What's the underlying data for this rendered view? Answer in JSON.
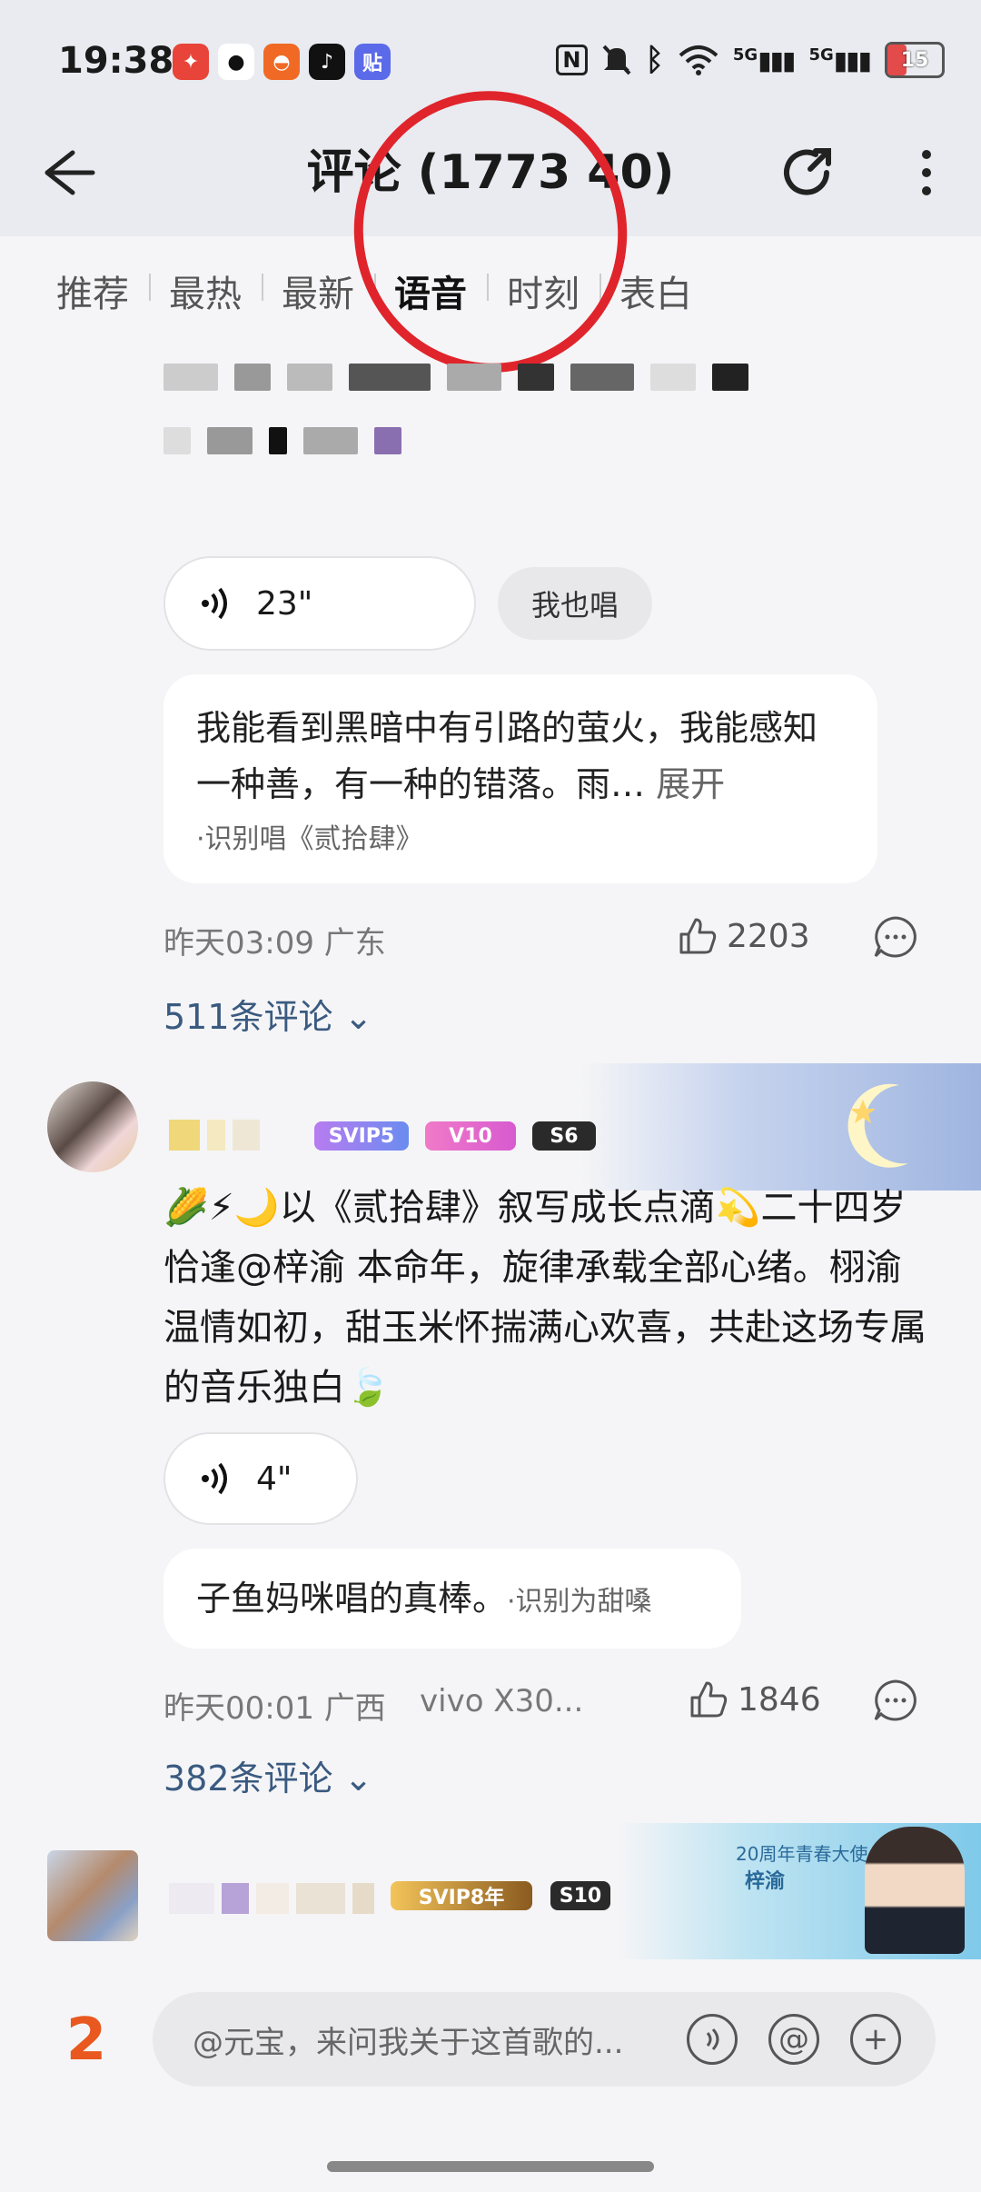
{
  "status_bar": {
    "time": "19:38",
    "app_badge": "贴",
    "network_1": "5G",
    "network_2": "5G",
    "battery": "15",
    "icons": [
      "nfc-icon",
      "mute-bell-icon",
      "bluetooth-icon",
      "wifi-icon",
      "signal-icon",
      "battery-icon"
    ]
  },
  "header": {
    "title": "评论 (1773 40)",
    "back_icon": "back-arrow-icon",
    "share_icon": "share-icon",
    "more_icon": "more-vertical-icon"
  },
  "tabs": [
    {
      "label": "推荐",
      "active": false
    },
    {
      "label": "最热",
      "active": false
    },
    {
      "label": "最新",
      "active": false
    },
    {
      "label": "语音",
      "active": true
    },
    {
      "label": "时刻",
      "active": false
    },
    {
      "label": "表白",
      "active": false
    }
  ],
  "comment1": {
    "voice_duration": "23\"",
    "sing_button": "我也唱",
    "lyric_text": "我能看到黑暗中有引路的萤火，我能感知一种善，有一种的错落。雨…",
    "expand": "展开",
    "recognized": "·识别唱《贰拾肆》",
    "time_location": "昨天03:09 广东",
    "likes": "2203",
    "replies": "511条评论"
  },
  "comment2": {
    "badges": [
      "SVIP5",
      "V10",
      "S6"
    ],
    "text": "🌽⚡🌙以《贰拾肆》叙写成长点滴💫二十四岁恰逢@梓渝 本命年，旋律承载全部心绪。栩渝温情如初，甜玉米怀揣满心欢喜，共赴这场专属的音乐独白🍃",
    "voice_duration": "4\"",
    "recognized_text": "子鱼妈咪唱的真棒。",
    "recognized_tag": "·识别为甜嗓",
    "time_location": "昨天00:01 广西",
    "device": "vivo X30...",
    "likes": "1846",
    "replies": "382条评论"
  },
  "comment3": {
    "badges": [
      "SVIP8年",
      "S10"
    ],
    "banner_line1": "20周年青春大使",
    "banner_line2": "梓渝"
  },
  "input_bar": {
    "placeholder": "@元宝，来问我关于这首歌的...",
    "yuanbao_logo": "2",
    "icons": [
      "voice-input-icon",
      "at-icon",
      "plus-icon"
    ]
  }
}
